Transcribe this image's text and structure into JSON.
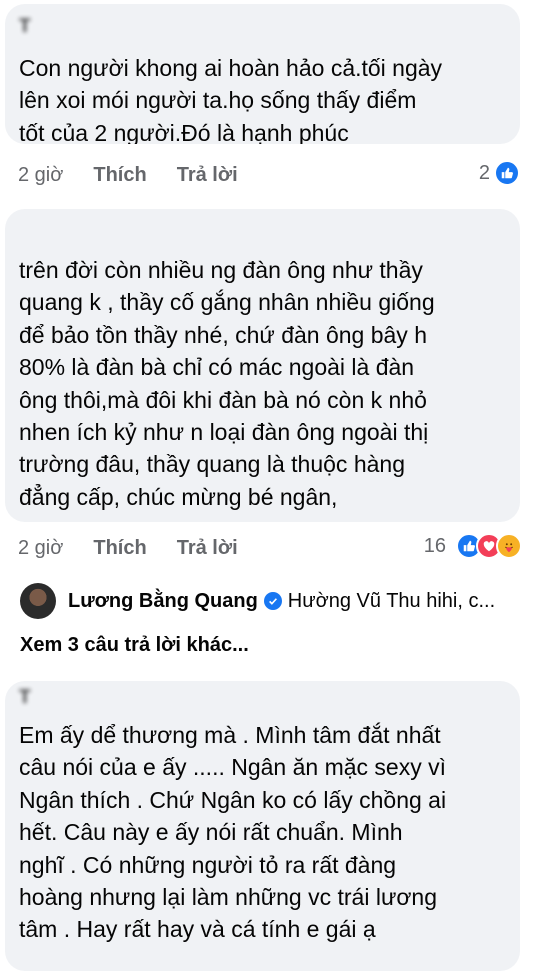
{
  "comments": [
    {
      "author": "T                          ",
      "text": "Con người khong ai hoàn hảo cả.tối ngày\nlên xoi mói người ta.họ sống thấy điểm\ntốt của 2 người.Đó là hạnh phúc",
      "time": "2 giờ",
      "like_label": "Thích",
      "reply_label": "Trả lời",
      "reaction_count": "2"
    },
    {
      "author": "                          ",
      "text": "trên đời còn nhiều ng đàn ông như thầy\nquang k , thầy cố gắng nhân nhiều giống\nđể bảo tồn thầy nhé, chứ đàn ông bây h\n80% là đàn bà chỉ có mác ngoài là đàn\nông thôi,mà đôi khi đàn bà nó còn k nhỏ\nnhen ích kỷ như n loại đàn ông ngoài thị\ntrường đâu,  thầy quang là thuộc hàng\nđẳng cấp, chúc mừng bé ngân,",
      "time": "2 giờ",
      "like_label": "Thích",
      "reply_label": "Trả lời",
      "reaction_count": "16"
    },
    {
      "author": "T                       ",
      "text": "Em ấy dể thương mà . Mình tâm đắt nhất\ncâu nói của e ấy ..... Ngân ăn mặc sexy vì\nNgân thích . Chứ Ngân ko có lấy chồng ai\nhết. Câu này e ấy nói rất chuẩn. Mình\nnghĩ . Có những người tỏ ra rất đàng\nhoàng nhưng lại làm những vc trái lương\ntâm . Hay rất hay và cá tính e gái ạ"
    }
  ],
  "reply": {
    "name": "Lương Bằng Quang",
    "snippet": "Hường Vũ Thu hihi, c..."
  },
  "more_replies": "Xem 3 câu trả lời khác...",
  "colors": {
    "like": "#1877f2",
    "love": "#f33e58",
    "care": "#f7b125"
  }
}
